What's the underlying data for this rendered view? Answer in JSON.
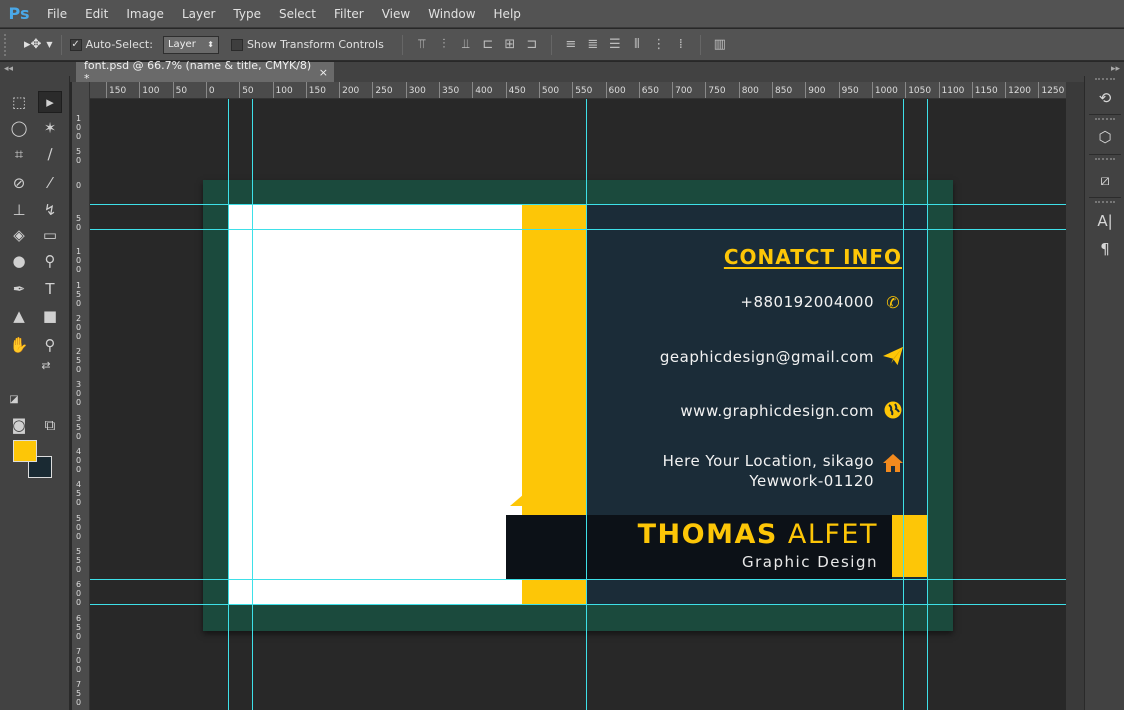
{
  "app": {
    "logo": "Ps"
  },
  "menu": [
    "File",
    "Edit",
    "Image",
    "Layer",
    "Type",
    "Select",
    "Filter",
    "View",
    "Window",
    "Help"
  ],
  "options": {
    "auto_select_label": "Auto-Select:",
    "auto_select_checked": true,
    "auto_select_target": "Layer",
    "transform_controls_label": "Show Transform Controls",
    "transform_controls_checked": false
  },
  "document": {
    "tab_title": "font.psd @ 66.7% (name & title, CMYK/8) *",
    "close": "×"
  },
  "rulers": {
    "horizontal": [
      "150",
      "100",
      "50",
      "0",
      "50",
      "100",
      "150",
      "200",
      "250",
      "300",
      "350",
      "400",
      "450",
      "500",
      "550",
      "600",
      "650",
      "700",
      "750",
      "800",
      "850",
      "900",
      "950",
      "1000",
      "1050",
      "1100",
      "1150",
      "1200",
      "1250"
    ],
    "vertical": [
      "100",
      "50",
      "0",
      "50",
      "100",
      "150",
      "200",
      "250",
      "300",
      "350",
      "400",
      "450",
      "500",
      "550",
      "600",
      "650",
      "700",
      "750"
    ]
  },
  "colors": {
    "foreground": "#fdc607",
    "background": "#1a2a33",
    "guide": "#3ee0e8",
    "accent": "#fdc607"
  },
  "card": {
    "contact_title": "CONATCT INFO",
    "phone": "+880192004000",
    "email": "geaphicdesign@gmail.com",
    "website": "www.graphicdesign.com",
    "address_line1": "Here Your Location, sikago",
    "address_line2": "Yewwork-01120",
    "name_first": "THOMAS",
    "name_last": "ALFET",
    "job_title": "Graphic Design"
  },
  "icons": {
    "phone": "phone-icon",
    "email": "paper-plane-icon",
    "website": "globe-icon",
    "address": "home-icon"
  }
}
